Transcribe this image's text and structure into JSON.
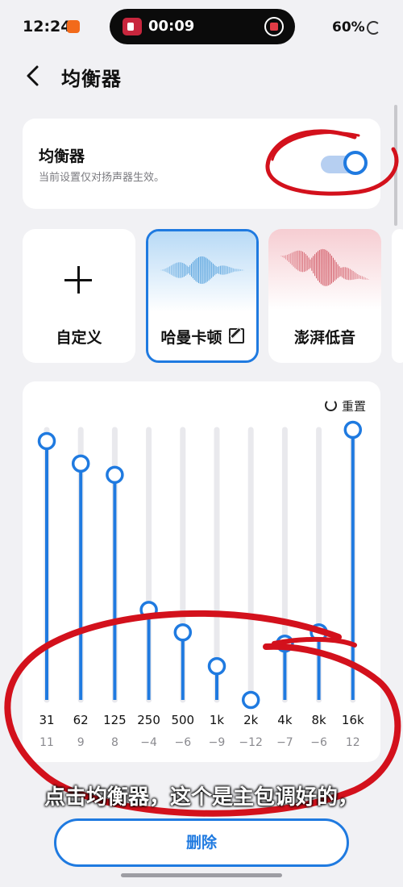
{
  "status_bar": {
    "time": "12:24",
    "recording_time": "00:09",
    "battery": "60%"
  },
  "header": {
    "title": "均衡器"
  },
  "equalizer_card": {
    "title": "均衡器",
    "subtitle": "当前设置仅对扬声器生效。",
    "enabled": true
  },
  "presets": [
    {
      "label": "自定义",
      "icon": "plus-icon",
      "selected": false
    },
    {
      "label": "哈曼卡顿",
      "icon": "edit-icon",
      "selected": true
    },
    {
      "label": "澎湃低音",
      "selected": false
    }
  ],
  "eq": {
    "reset_label": "重置",
    "range_db": [
      -12,
      12
    ],
    "bands": [
      {
        "freq": "31",
        "gain": 11
      },
      {
        "freq": "62",
        "gain": 9
      },
      {
        "freq": "125",
        "gain": 8
      },
      {
        "freq": "250",
        "gain": -4
      },
      {
        "freq": "500",
        "gain": -6
      },
      {
        "freq": "1k",
        "gain": -9
      },
      {
        "freq": "2k",
        "gain": -12
      },
      {
        "freq": "4k",
        "gain": -7
      },
      {
        "freq": "8k",
        "gain": -6
      },
      {
        "freq": "16k",
        "gain": 12
      }
    ]
  },
  "subtitle": "点击均衡器，这个是主包调好的，",
  "delete_button": {
    "label": "删除"
  },
  "colors": {
    "accent": "#1f7ae0",
    "annotation": "#d3111c"
  }
}
